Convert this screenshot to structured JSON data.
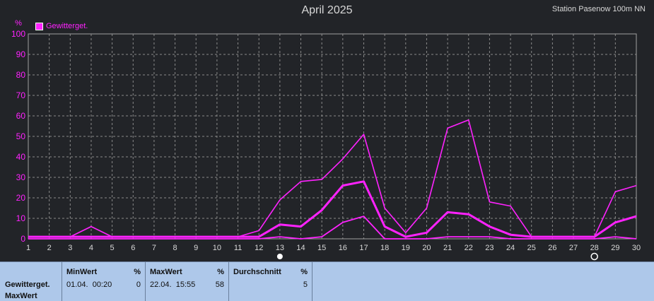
{
  "header": {
    "title": "April 2025",
    "station": "Station Pasenow 100m NN",
    "y_unit": "%"
  },
  "legend": {
    "label": "Gewitterget."
  },
  "colors": {
    "series": "#ff22ff",
    "grid": "#8a8a8a",
    "axis_text": "#ff22ff",
    "x_text": "#d8d8d8"
  },
  "markers": {
    "full_moon_day": 13,
    "new_moon_day": 28
  },
  "chart_data": {
    "type": "line",
    "title": "April 2025",
    "ylabel": "%",
    "ylim": [
      0,
      100
    ],
    "yticks": [
      0,
      10,
      20,
      30,
      40,
      50,
      60,
      70,
      80,
      90,
      100
    ],
    "xlim": [
      1,
      30
    ],
    "x": [
      1,
      2,
      3,
      4,
      5,
      6,
      7,
      8,
      9,
      10,
      11,
      12,
      13,
      14,
      15,
      16,
      17,
      18,
      19,
      20,
      21,
      22,
      23,
      24,
      25,
      26,
      27,
      28,
      29,
      30
    ],
    "series": [
      {
        "name": "max",
        "values": [
          1,
          1,
          1,
          6,
          1,
          1,
          1,
          1,
          1,
          1,
          1,
          4,
          19,
          28,
          29,
          39,
          51,
          15,
          3,
          15,
          54,
          58,
          18,
          16,
          1,
          1,
          1,
          1,
          23,
          26
        ]
      },
      {
        "name": "avg",
        "values": [
          1,
          1,
          1,
          1,
          1,
          1,
          1,
          1,
          1,
          1,
          1,
          1,
          7,
          6,
          14,
          26,
          28,
          6,
          1,
          3,
          13,
          12,
          6,
          2,
          1,
          1,
          1,
          1,
          8,
          11
        ]
      },
      {
        "name": "min",
        "values": [
          0,
          0,
          0,
          0,
          0,
          0,
          0,
          0,
          0,
          0,
          0,
          0,
          1,
          0,
          1,
          8,
          11,
          0,
          0,
          0,
          1,
          1,
          1,
          0,
          0,
          0,
          0,
          0,
          1,
          0
        ]
      }
    ]
  },
  "table": {
    "row_label_1": "Gewitterget.",
    "row_label_2": "MaxWert",
    "min": {
      "title": "MinWert",
      "unit": "%",
      "time": "01.04.  00:20",
      "value": "0"
    },
    "max": {
      "title": "MaxWert",
      "unit": "%",
      "time": "22.04.  15:55",
      "value": "58"
    },
    "avg": {
      "title": "Durchschnitt",
      "unit": "%",
      "value": "5"
    }
  }
}
